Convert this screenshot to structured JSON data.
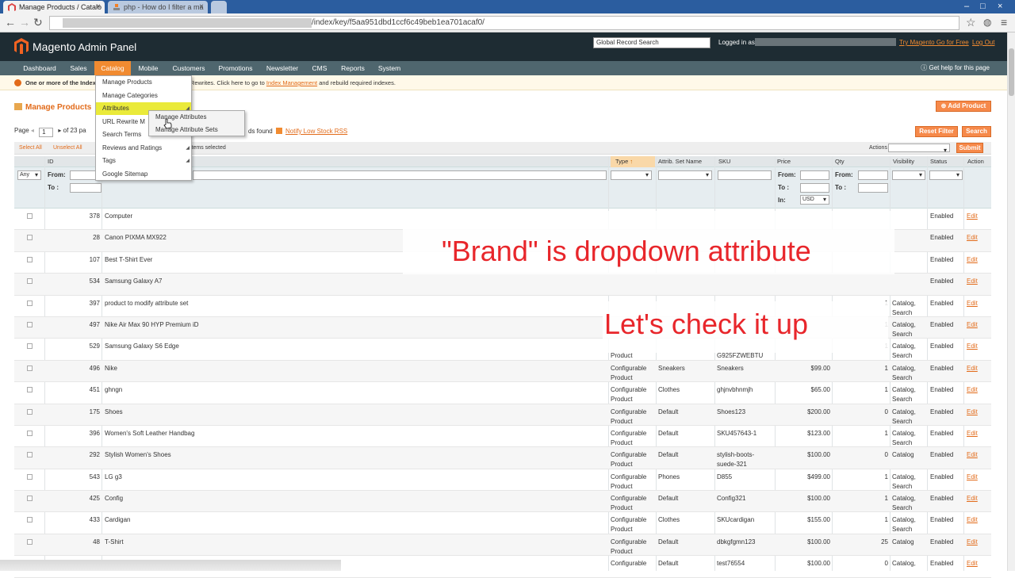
{
  "browser": {
    "tabs": [
      {
        "label": "Manage Products / Catalo",
        "active": true
      },
      {
        "label": "php - How do I filter a ma",
        "active": false
      }
    ],
    "url_path": "/index/key/f5aa951dbd1ccf6c49beb1ea701acaf0/"
  },
  "header": {
    "logo": "Magento",
    "logo_suffix": "Admin Panel",
    "global_search_placeholder": "Global Record Search",
    "logged_in_label": "Logged in as",
    "try_link": "Try Magento Go for Free",
    "logout": "Log Out"
  },
  "nav": {
    "items": [
      "Dashboard",
      "Sales",
      "Catalog",
      "Mobile",
      "Customers",
      "Promotions",
      "Newsletter",
      "CMS",
      "Reports",
      "System"
    ],
    "help": "Get help for this page"
  },
  "notice": {
    "lead": "One or more of the Index",
    "text": "Rewrites. Click here to go to",
    "link": "Index Management",
    "tail": "and rebuild required indexes."
  },
  "catalog_menu": {
    "items": [
      "Manage Products",
      "Manage Categories",
      "Attributes",
      "URL Rewrite M",
      "Search Terms",
      "Reviews and Ratings",
      "Tags",
      "Google Sitemap"
    ],
    "submenu": [
      "Manage Attributes",
      "Manage Attribute Sets"
    ]
  },
  "page": {
    "title": "Manage Products",
    "add_product": "Add Product",
    "reset_filter": "Reset Filter",
    "search": "Search",
    "page_label": "Page",
    "page_value": "1",
    "of_pages": "of 23 pa",
    "records_found": "ds found",
    "notify_rss": "Notify Low Stock RSS",
    "select_all": "Select All",
    "unselect_all": "Unselect All",
    "items_selected": "items selected",
    "actions": "Actions",
    "submit": "Submit"
  },
  "grid": {
    "headers": {
      "id": "ID",
      "type": "Type",
      "attr_set": "Attrib. Set Name",
      "sku": "SKU",
      "price": "Price",
      "qty": "Qty",
      "visibility": "Visibility",
      "status": "Status",
      "action": "Action"
    },
    "filter": {
      "any": "Any",
      "from": "From:",
      "to": "To :",
      "in": "In:",
      "currency": "USD"
    },
    "rows": [
      {
        "id": "378",
        "name": "Computer",
        "type": "",
        "type2": "",
        "set": "",
        "sku": "",
        "sku2": "",
        "price": "",
        "qty": "",
        "vis": "",
        "vis2": "",
        "status": "Enabled",
        "edit": "Edit"
      },
      {
        "id": "28",
        "name": "Canon PIXMA MX922",
        "type": "",
        "type2": "",
        "set": "",
        "sku": "",
        "sku2": "",
        "price": "",
        "qty": "",
        "vis": "",
        "vis2": "",
        "status": "Enabled",
        "edit": "Edit"
      },
      {
        "id": "107",
        "name": "Best T-Shirt Ever",
        "type": "",
        "type2": "",
        "set": "",
        "sku": "",
        "sku2": "",
        "price": "",
        "qty": "",
        "vis": "",
        "vis2": "",
        "status": "Enabled",
        "edit": "Edit"
      },
      {
        "id": "534",
        "name": "Samsung Galaxy A7",
        "type": "",
        "type2": "",
        "set": "",
        "sku": "",
        "sku2": "",
        "price": "",
        "qty": "",
        "vis": "",
        "vis2": "",
        "status": "Enabled",
        "edit": "Edit"
      },
      {
        "id": "397",
        "name": "product to modify attribute set",
        "type": "",
        "type2": "",
        "set": "",
        "sku": "",
        "sku2": "",
        "price": "",
        "qty": "1",
        "vis": "Catalog,",
        "vis2": "Search",
        "status": "Enabled",
        "edit": "Edit"
      },
      {
        "id": "497",
        "name": "Nike Air Max 90 HYP Premium iD",
        "type": "",
        "type2": "",
        "set": "",
        "sku": "",
        "sku2": "",
        "price": "",
        "qty": "1",
        "vis": "Catalog,",
        "vis2": "Search",
        "status": "Enabled",
        "edit": "Edit"
      },
      {
        "id": "529",
        "name": "Samsung Galaxy S6 Edge",
        "type": "",
        "type2": "Product",
        "set": "",
        "sku": "",
        "sku2": "G925FZWEBTU",
        "price": "",
        "qty": "1",
        "vis": "Catalog,",
        "vis2": "Search",
        "status": "Enabled",
        "edit": "Edit"
      },
      {
        "id": "496",
        "name": "Nike",
        "type": "Configurable",
        "type2": "Product",
        "set": "Sneakers",
        "sku": "Sneakers",
        "sku2": "",
        "price": "$99.00",
        "qty": "1",
        "vis": "Catalog,",
        "vis2": "Search",
        "status": "Enabled",
        "edit": "Edit"
      },
      {
        "id": "451",
        "name": "ghngn",
        "type": "Configurable",
        "type2": "Product",
        "set": "Clothes",
        "sku": "ghjnvbhnmjh",
        "sku2": "",
        "price": "$65.00",
        "qty": "1",
        "vis": "Catalog,",
        "vis2": "Search",
        "status": "Enabled",
        "edit": "Edit"
      },
      {
        "id": "175",
        "name": "Shoes",
        "type": "Configurable",
        "type2": "Product",
        "set": "Default",
        "sku": "Shoes123",
        "sku2": "",
        "price": "$200.00",
        "qty": "0",
        "vis": "Catalog,",
        "vis2": "Search",
        "status": "Enabled",
        "edit": "Edit"
      },
      {
        "id": "396",
        "name": "Women's Soft Leather Handbag",
        "type": "Configurable",
        "type2": "Product",
        "set": "Default",
        "sku": "SKU457643-1",
        "sku2": "",
        "price": "$123.00",
        "qty": "1",
        "vis": "Catalog,",
        "vis2": "Search",
        "status": "Enabled",
        "edit": "Edit"
      },
      {
        "id": "292",
        "name": "Stylish Women's Shoes",
        "type": "Configurable",
        "type2": "Product",
        "set": "Default",
        "sku": "stylish-boots-",
        "sku2": "suede-321",
        "price": "$100.00",
        "qty": "0",
        "vis": "Catalog",
        "vis2": "",
        "status": "Enabled",
        "edit": "Edit"
      },
      {
        "id": "543",
        "name": "LG g3",
        "type": "Configurable",
        "type2": "Product",
        "set": "Phones",
        "sku": "D855",
        "sku2": "",
        "price": "$499.00",
        "qty": "1",
        "vis": "Catalog,",
        "vis2": "Search",
        "status": "Enabled",
        "edit": "Edit"
      },
      {
        "id": "425",
        "name": "Config",
        "type": "Configurable",
        "type2": "Product",
        "set": "Default",
        "sku": "Config321",
        "sku2": "",
        "price": "$100.00",
        "qty": "1",
        "vis": "Catalog,",
        "vis2": "Search",
        "status": "Enabled",
        "edit": "Edit"
      },
      {
        "id": "433",
        "name": "Cardigan",
        "type": "Configurable",
        "type2": "Product",
        "set": "Clothes",
        "sku": "SKUcardigan",
        "sku2": "",
        "price": "$155.00",
        "qty": "1",
        "vis": "Catalog,",
        "vis2": "Search",
        "status": "Enabled",
        "edit": "Edit"
      },
      {
        "id": "48",
        "name": "T-Shirt",
        "type": "Configurable",
        "type2": "Product",
        "set": "Default",
        "sku": "dbkgfgmn123",
        "sku2": "",
        "price": "$100.00",
        "qty": "25",
        "vis": "Catalog",
        "vis2": "",
        "status": "Enabled",
        "edit": "Edit"
      },
      {
        "id": "",
        "name": "",
        "type": "Configurable",
        "type2": "",
        "set": "Default",
        "sku": "test76554",
        "sku2": "",
        "price": "$100.00",
        "qty": "0",
        "vis": "Catalog,",
        "vis2": "",
        "status": "Enabled",
        "edit": "Edit"
      }
    ]
  },
  "overlay": {
    "line1": "\"Brand\" is dropdown attribute",
    "line2": "Let's check it up"
  },
  "colors": {
    "accent": "#f18b31",
    "nav": "#4f666e",
    "header": "#1e2c33",
    "overlay_text": "#e8262b"
  }
}
